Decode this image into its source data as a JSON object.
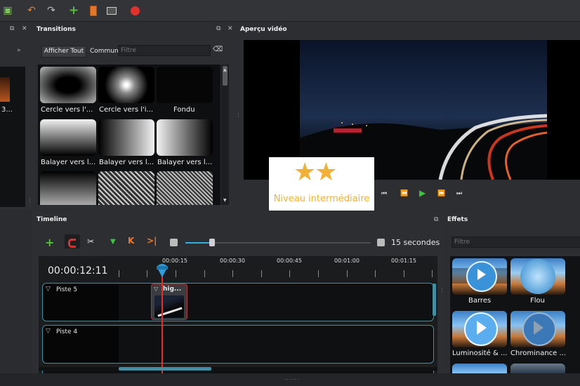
{
  "transitions": {
    "title": "Transitions",
    "show_all": "Afficher Tout",
    "common": "Commun",
    "filter_placeholder": "Filtre",
    "items": [
      "Cercle vers l'...",
      "Cercle vers l'i...",
      "Fondu",
      "Balayer vers l...",
      "Balayer vers l...",
      "Balayer vers l..."
    ]
  },
  "left_panel": {
    "arrows": "»",
    "partial_label": "3..."
  },
  "preview": {
    "title": "Aperçu vidéo"
  },
  "badge": {
    "text": "Niveau intermédiaire",
    "stars": "★★"
  },
  "timeline": {
    "title": "Timeline",
    "duration": "15 secondes",
    "current_time": "00:00:12:11",
    "ruler": [
      "00:00:15",
      "00:00:30",
      "00:00:45",
      "00:01:00",
      "00:01:15"
    ],
    "tracks": [
      "Piste 5",
      "Piste 4"
    ],
    "clip_label": "hig..."
  },
  "effects": {
    "title": "Effets",
    "filter_placeholder": "Filtre",
    "items": [
      "Barres",
      "Flou",
      "Luminosité & ...",
      "Chrominance ..."
    ]
  },
  "colors": {
    "accent": "#3f8fa6",
    "playhead": "#e0312e",
    "record": "#e0312e",
    "play": "#3fc43f"
  }
}
